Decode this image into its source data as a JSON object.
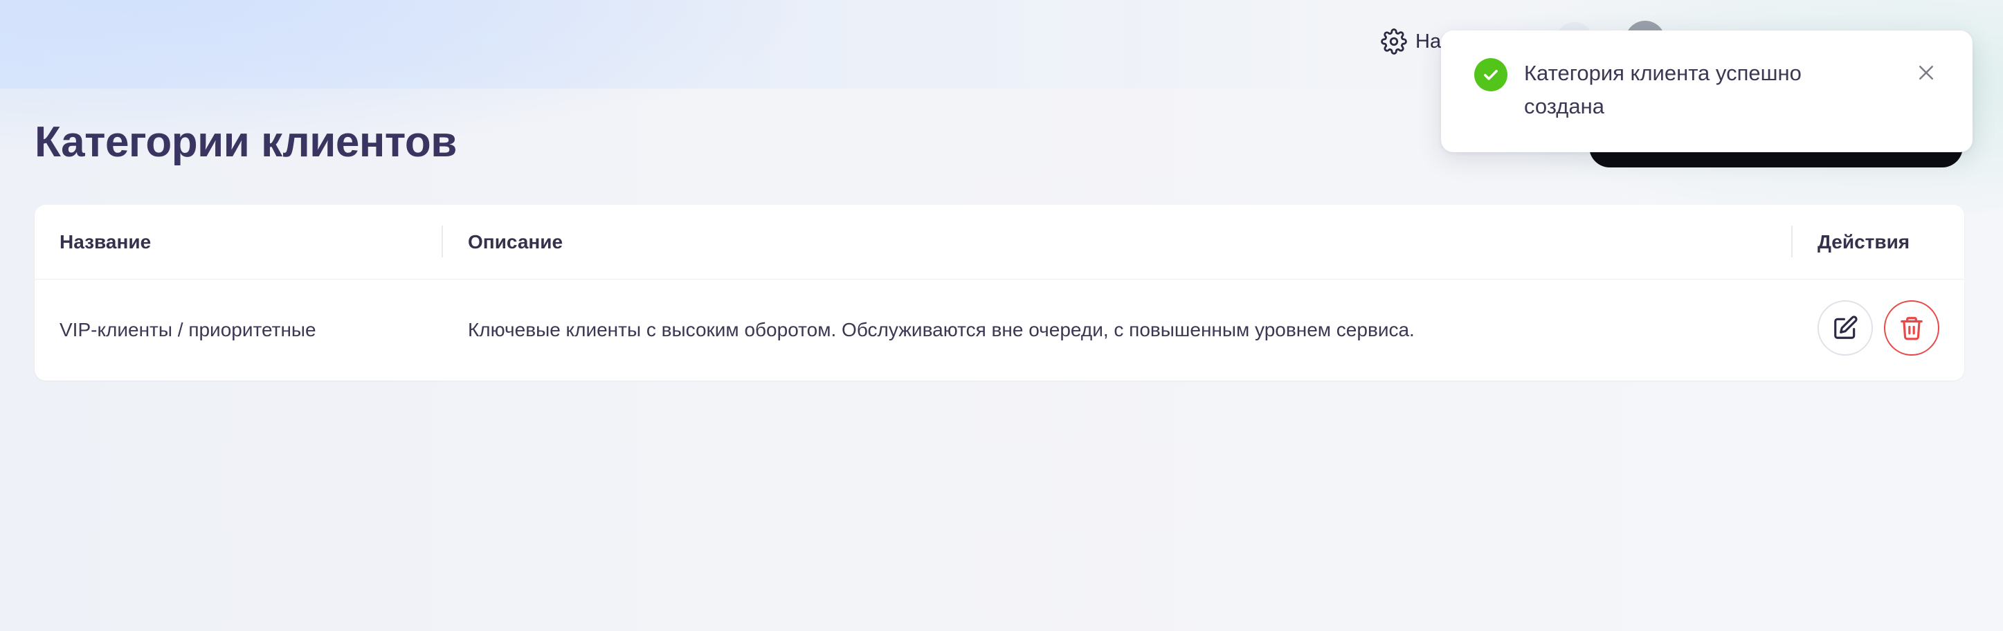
{
  "header": {
    "settings_label": "На",
    "icons": {
      "settings": "gear-icon",
      "help": "help-icon",
      "avatar": "avatar"
    }
  },
  "page": {
    "title": "Категории клиентов",
    "add_button_label": ""
  },
  "table": {
    "columns": [
      "Название",
      "Описание",
      "Действия"
    ],
    "rows": [
      {
        "name": "VIP-клиенты / приоритетные",
        "description": "Ключевые клиенты с высоким оборотом. Обслуживаются вне очереди, с повышенным уровнем сервиса."
      }
    ],
    "row_actions": [
      "edit-icon",
      "trash-icon"
    ]
  },
  "toast": {
    "message": "Категория клиента успешно создана",
    "status": "success",
    "icon": "check-circle-icon"
  },
  "colors": {
    "title": "#3a3560",
    "success": "#52c41a",
    "danger": "#e84848",
    "primary_button": "#0c0c10"
  }
}
